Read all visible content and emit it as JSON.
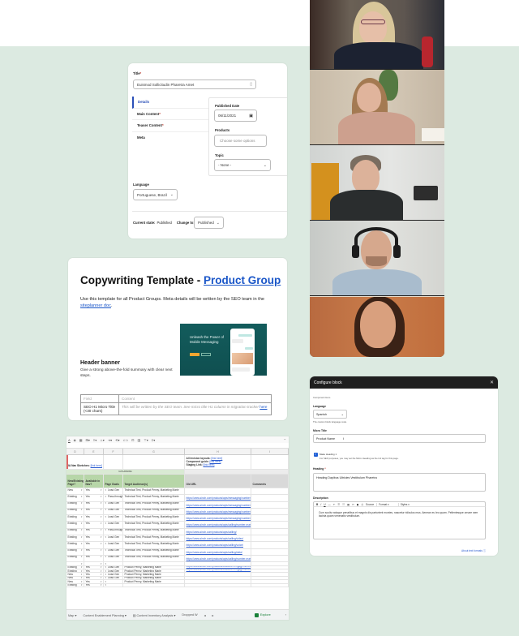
{
  "cms_form": {
    "title_label": "Title",
    "title_value": "Euismod Sollicitudin Pharetra Amet",
    "tabs": [
      {
        "label": "Details",
        "required": false,
        "active": true
      },
      {
        "label": "Main Content",
        "required": true,
        "active": false
      },
      {
        "label": "Teaser Content",
        "required": true,
        "active": false
      },
      {
        "label": "Meta",
        "required": false,
        "active": false
      }
    ],
    "published_date_label": "Published Date",
    "published_date_value": "06/11/2021",
    "products_label": "Products",
    "products_placeholder": "Choose some options",
    "topic_label": "Topic",
    "topic_value": "- None -",
    "language_label": "Language",
    "language_value": "Portuguese, Brazil",
    "current_state_label": "Current state:",
    "current_state_value": "Published",
    "change_to_label": "Change to:",
    "change_to_value": "Published"
  },
  "doc": {
    "title_prefix": "Copywriting Template - ",
    "title_link": "Product Group",
    "intro_text": "Use this template for all Product Groups. Meta details will be written by the SEO team in the ",
    "intro_link": "siteplanner doc",
    "intro_suffix": ".",
    "banner": {
      "headline": "Unleash the Power of Mobile Messaging"
    },
    "section_title": "Header banner",
    "section_desc": "Give a strong above-the-fold summary with clear next steps.",
    "table": {
      "headers": [
        "Field",
        "Content"
      ],
      "rows": [
        {
          "field": "SEO H1 Micro Title (<30 chars)",
          "content": "This will be written by the SEO team. See micro title H1 column in migration tracker ",
          "link": "here"
        }
      ]
    }
  },
  "spreadsheet": {
    "toolbar_icons": [
      "text-color",
      "paint",
      "borders",
      "merge",
      "align-left",
      "align-bottom",
      "wrap",
      "rotate",
      "link",
      "comment",
      "chart",
      "filter",
      "functions"
    ],
    "columns": [
      "D",
      "E",
      "F",
      "G",
      "H",
      "I"
    ],
    "links_block": [
      {
        "label": "All Invision layouts:",
        "link": "[link here]"
      },
      {
        "label": "Component guide:",
        "link": "[link here]"
      },
      {
        "label": "Staging Link:",
        "link": "[link here]"
      }
    ],
    "ia_nav_label": "IA Nav Sketches:",
    "ia_nav_link": "[link here]",
    "band_label": "IA PLANNING",
    "headers": [
      "New/Existing Page?",
      "Available in Nav?",
      "Page Goals",
      "Target Audience(s)",
      "Old URL",
      "Comments"
    ],
    "rows": [
      {
        "status": "New",
        "nav": "Yes",
        "goal": "Lead Gen",
        "audience": "Technical Text, Product Penny, Marketing Marie",
        "url": ""
      },
      {
        "status": "Existing",
        "nav": "Yes",
        "goal": "Pass-through / Overview",
        "audience": "Technical Text, Product Penny, Marketing Marie",
        "url": "https://www.sinch.com/products/apis/messaging/numbers/"
      },
      {
        "status": "Existing",
        "nav": "Yes",
        "goal": "Lead Gen",
        "audience": "Technical Text, Product Penny, Marketing Marie",
        "url": "https://www.sinch.com/products/apis/messaging/numbers/long-numbers/"
      },
      {
        "status": "Existing",
        "nav": "Yes",
        "goal": "Lead Gen",
        "audience": "Technical Text, Product Penny, Marketing Marie",
        "url": "https://www.sinch.com/products/apis/messaging/numbers/short-codes/"
      },
      {
        "status": "Existing",
        "nav": "Yes",
        "goal": "Lead Gen",
        "audience": "Technical Text, Product Penny, Marketing Marie",
        "url": "https://www.sinch.com/products/apis/messaging/numbers/10dlc-messaging/"
      },
      {
        "status": "Existing",
        "nav": "Yes",
        "goal": "Lead Gen",
        "audience": "Technical Text, Product Penny, Marketing Marie",
        "url": "https://www.sinch.com/products/apis/calling/number-masking/"
      },
      {
        "status": "Existing",
        "nav": "Yes",
        "goal": "Pass-through / Overview",
        "audience": "Technical Text, Product Penny, Marketing Marie",
        "url": "https://www.sinch.com/products/apis/calling/"
      },
      {
        "status": "Existing",
        "nav": "Yes",
        "goal": "Lead Gen",
        "audience": "Technical Text, Product Penny, Marketing Marie",
        "url": "https://www.sinch.com/products/apis/calling/video/"
      },
      {
        "status": "Existing",
        "nav": "Yes",
        "goal": "Lead Gen",
        "audience": "Technical Text, Product Penny, Marketing Marie",
        "url": "https://www.sinch.com/products/apis/calling/voice/"
      },
      {
        "status": "Existing",
        "nav": "Yes",
        "goal": "Lead Gen",
        "audience": "Technical Text, Product Penny, Marketing Marie",
        "url": "https://www.sinch.com/products/apis/calling/data/"
      },
      {
        "status": "Existing",
        "nav": "Yes",
        "goal": "Lead Gen",
        "audience": "Technical Text, Product Penny, Marketing Marie",
        "url": "https://www.sinch.com/products/apis/calling/number-masking/"
      },
      {
        "status": "",
        "nav": "",
        "goal": "",
        "audience": "",
        "url": ""
      },
      {
        "status": "Existing",
        "nav": "Yes",
        "goal": "Lead Gen",
        "audience": "Product Penny, Marketing Marie",
        "url": "https://www.sinch.com/products/customer-engagement/campaigns/"
      },
      {
        "status": "Existing",
        "nav": "Yes",
        "goal": "Lead Gen",
        "audience": "Product Penny, Marketing Marie",
        "url": "https://www.sinch.com/products/customer-engagement/chatbots-ai/"
      },
      {
        "status": "New",
        "nav": "Yes",
        "goal": "Lead Gen",
        "audience": "Product Penny, Marketing Marie",
        "url": ""
      },
      {
        "status": "New",
        "nav": "Yes",
        "goal": "Lead Gen",
        "audience": "Product Penny, Marketing Marie",
        "url": ""
      },
      {
        "status": "New",
        "nav": "Yes",
        "goal": "",
        "audience": "Product Penny, Marketing Marie",
        "url": ""
      },
      {
        "status": "Existing",
        "nav": "Yes",
        "goal": "",
        "audience": "",
        "url": ""
      }
    ],
    "sheet_tabs": [
      "Map",
      "Content Enablement Planning",
      "Content Inventory Analysis",
      "Dropped W"
    ],
    "explore_label": "Explore"
  },
  "video_call": {
    "participants": 5
  },
  "configure_block": {
    "title": "Configure block",
    "component_hint": "Component Hero",
    "language_label": "Language",
    "language_value": "Spanish",
    "language_help": "The custom block language code.",
    "micro_title_label": "Micro Title",
    "micro_title_value": "Product Name",
    "make_heading_label": "Make Heading 1",
    "make_heading_checked": true,
    "make_heading_help": "For SEO purposes, you may set the Micro Heading as the H1 tag for this page.",
    "heading_label": "Heading",
    "heading_value": "Heading Dapibus Ultricies Vestibulum Pharetra",
    "description_label": "Description",
    "rte_toolbar": [
      "B",
      "I",
      "U",
      "—",
      "↶",
      "☰",
      "☷",
      "▦",
      "⚯",
      "◼",
      "⎙",
      "Source",
      "Format",
      "Styles"
    ],
    "description_value": "Cum sociis natoque penatibus et magnis dis parturient montes, nascetur ridiculus mus. Aenean eu leo quam. Pellentesque ornare sem lacinia quam venenatis vestibulum.",
    "about_text_formats": "About text formats"
  },
  "colors": {
    "mint_bg": "#dceae1",
    "link_blue": "#1a56c8",
    "sheet_header_green": "#b7d6a8",
    "banner_teal": "#135c5c",
    "modal_dark": "#1f1f1f",
    "checkbox_blue": "#1f5fd6"
  }
}
